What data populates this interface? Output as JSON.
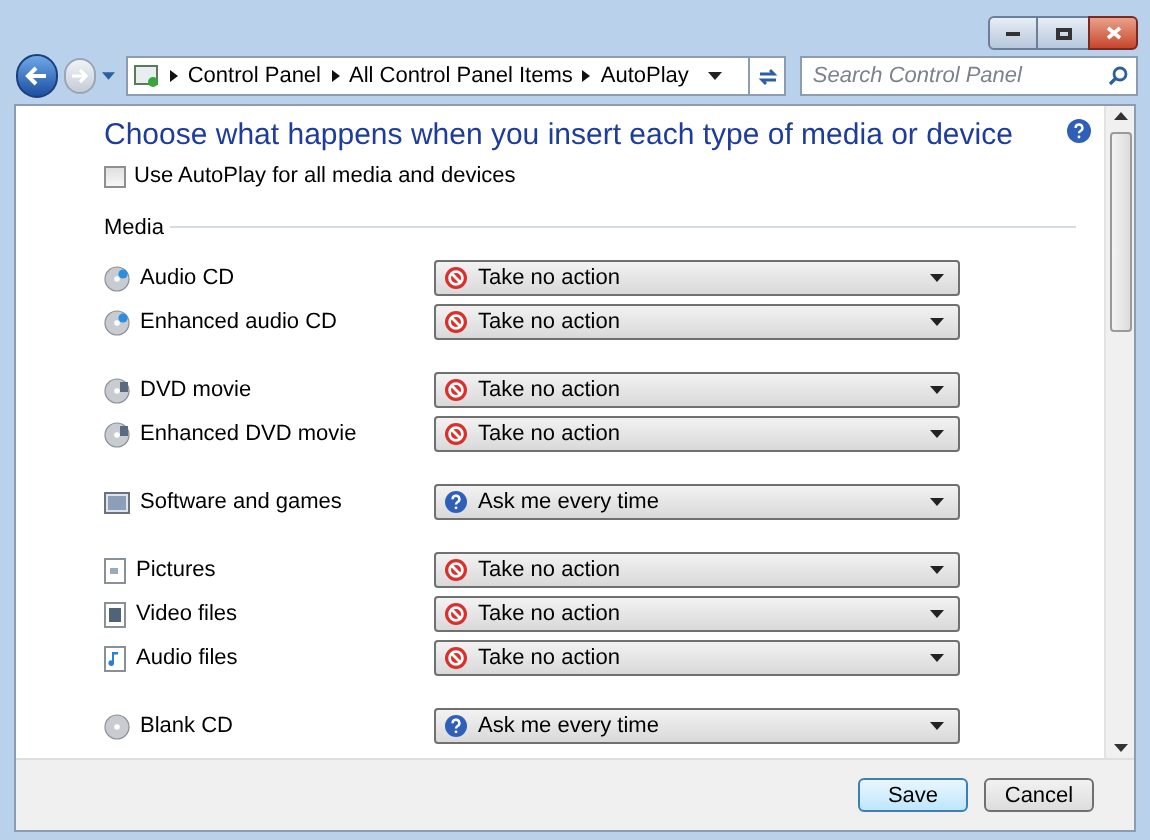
{
  "breadcrumb": [
    "Control Panel",
    "All Control Panel Items",
    "AutoPlay"
  ],
  "search": {
    "placeholder": "Search Control Panel"
  },
  "heading": "Choose what happens when you insert each type of media or device",
  "use_autoplay": {
    "label": "Use AutoPlay for all media and devices",
    "checked": false
  },
  "section": "Media",
  "groups": [
    {
      "items": [
        {
          "label": "Audio CD",
          "action": "Take no action",
          "kind": "none"
        },
        {
          "label": "Enhanced audio CD",
          "action": "Take no action",
          "kind": "none"
        }
      ]
    },
    {
      "items": [
        {
          "label": "DVD movie",
          "action": "Take no action",
          "kind": "none"
        },
        {
          "label": "Enhanced DVD movie",
          "action": "Take no action",
          "kind": "none"
        }
      ]
    },
    {
      "items": [
        {
          "label": "Software and games",
          "action": "Ask me every time",
          "kind": "ask"
        }
      ]
    },
    {
      "items": [
        {
          "label": "Pictures",
          "action": "Take no action",
          "kind": "none"
        },
        {
          "label": "Video files",
          "action": "Take no action",
          "kind": "none"
        },
        {
          "label": "Audio files",
          "action": "Take no action",
          "kind": "none"
        }
      ]
    },
    {
      "items": [
        {
          "label": "Blank CD",
          "action": "Ask me every time",
          "kind": "ask"
        }
      ]
    }
  ],
  "buttons": [
    {
      "label": "Save",
      "default": true
    },
    {
      "label": "Cancel",
      "default": false
    }
  ]
}
